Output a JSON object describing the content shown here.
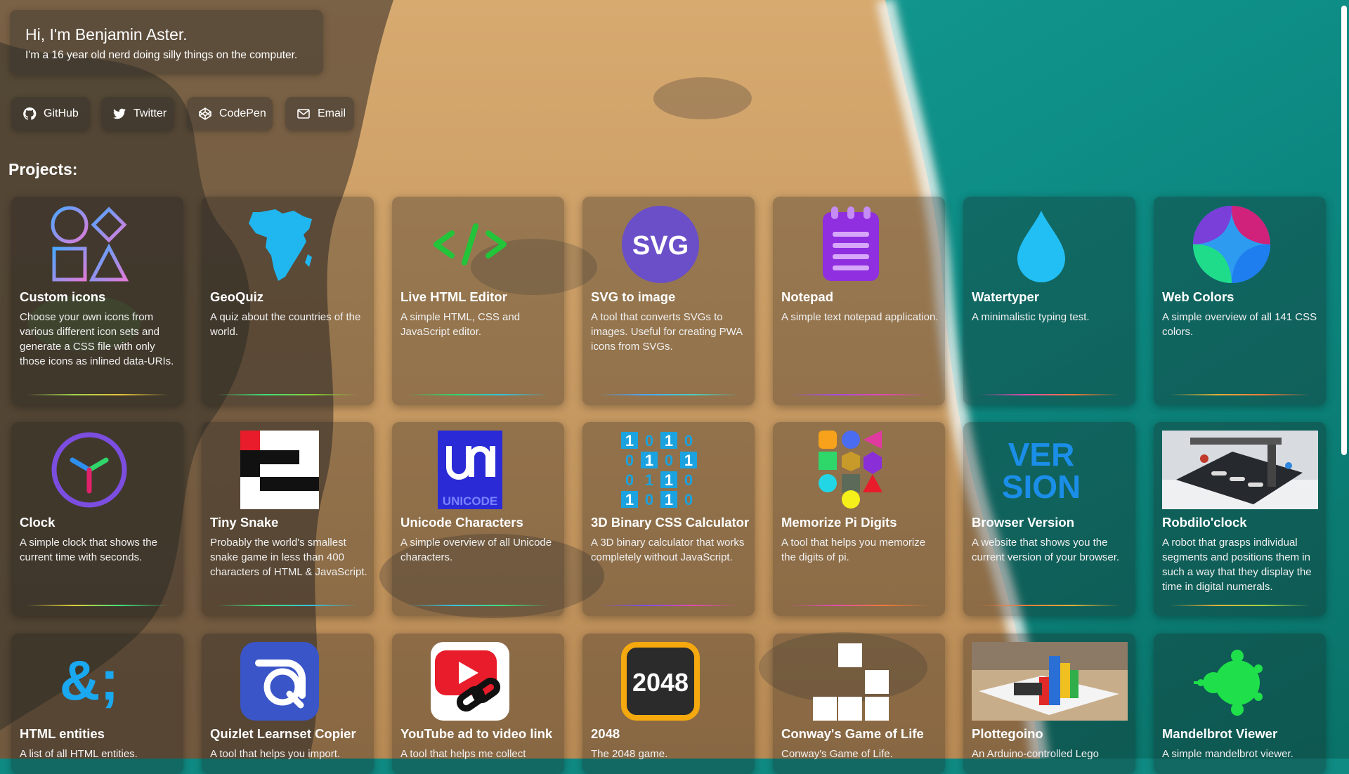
{
  "intro": {
    "heading": "Hi, I'm Benjamin Aster.",
    "tagline": "I'm a 16 year old nerd doing silly things on the computer."
  },
  "links": [
    {
      "label": "GitHub",
      "icon": "github-icon"
    },
    {
      "label": "Twitter",
      "icon": "twitter-icon"
    },
    {
      "label": "CodePen",
      "icon": "codepen-icon"
    },
    {
      "label": "Email",
      "icon": "email-icon"
    }
  ],
  "projects_heading": "Projects:",
  "colors": {
    "text": "#ffffff",
    "sea": "#0f8b83",
    "sand": "#c8995e"
  },
  "projects": [
    {
      "title": "Custom icons",
      "description": "Choose your own icons from various different icon sets and generate a CSS file with only those icons as inlined data-URIs.",
      "icon": "shapes-icon"
    },
    {
      "title": "GeoQuiz",
      "description": "A quiz about the countries of the world.",
      "icon": "africa-map-icon"
    },
    {
      "title": "Live HTML Editor",
      "description": "A simple HTML, CSS and JavaScript editor.",
      "icon": "code-brackets-icon"
    },
    {
      "title": "SVG to image",
      "description": "A tool that converts SVGs to images. Useful for creating PWA icons from SVGs.",
      "icon": "svg-badge-icon",
      "icon_text": "SVG"
    },
    {
      "title": "Notepad",
      "description": "A simple text notepad application.",
      "icon": "notepad-icon"
    },
    {
      "title": "Watertyper",
      "description": "A minimalistic typing test.",
      "icon": "water-drop-icon"
    },
    {
      "title": "Web Colors",
      "description": "A simple overview of all 141 CSS colors.",
      "icon": "color-star-icon"
    },
    {
      "title": "Clock",
      "description": "A simple clock that shows the current time with seconds.",
      "icon": "clock-icon"
    },
    {
      "title": "Tiny Snake",
      "description": "Probably the world's smallest snake game in less than 400 characters of HTML & JavaScript.",
      "icon": "snake-icon"
    },
    {
      "title": "Unicode Characters",
      "description": "A simple overview of all Unicode characters.",
      "icon": "unicode-logo-icon",
      "icon_text": "UNICODE"
    },
    {
      "title": "3D Binary CSS Calculator",
      "description": "A 3D binary calculator that works completely without JavaScript.",
      "icon": "binary-grid-icon"
    },
    {
      "title": "Memorize Pi Digits",
      "description": "A tool that helps you memorize the digits of pi.",
      "icon": "color-shapes-icon"
    },
    {
      "title": "Browser Version",
      "description": "A website that shows you the current version of your browser.",
      "icon": "version-text-icon",
      "icon_text": "VER SION"
    },
    {
      "title": "Robdilo'clock",
      "description": "A robot that grasps individual segments and positions them in such a way that they display the time in digital numerals.",
      "icon": "robot-photo-icon"
    },
    {
      "title": "HTML entities",
      "description": "A list of all HTML entities.",
      "icon": "entity-icon",
      "icon_text": "&;"
    },
    {
      "title": "Quizlet Learnset Copier",
      "description": "A tool that helps you import.",
      "icon": "quizlet-icon"
    },
    {
      "title": "YouTube ad to video link",
      "description": "A tool that helps me collect",
      "icon": "youtube-link-icon"
    },
    {
      "title": "2048",
      "description": "The 2048 game.",
      "icon": "2048-tile-icon",
      "icon_text": "2048"
    },
    {
      "title": "Conway's Game of Life",
      "description": "Conway's Game of Life.",
      "icon": "glider-icon"
    },
    {
      "title": "Plottegoino",
      "description": "An Arduino-controlled Lego",
      "icon": "lego-plotter-photo-icon"
    },
    {
      "title": "Mandelbrot Viewer",
      "description": "A simple mandelbrot viewer.",
      "icon": "mandelbrot-icon"
    }
  ]
}
